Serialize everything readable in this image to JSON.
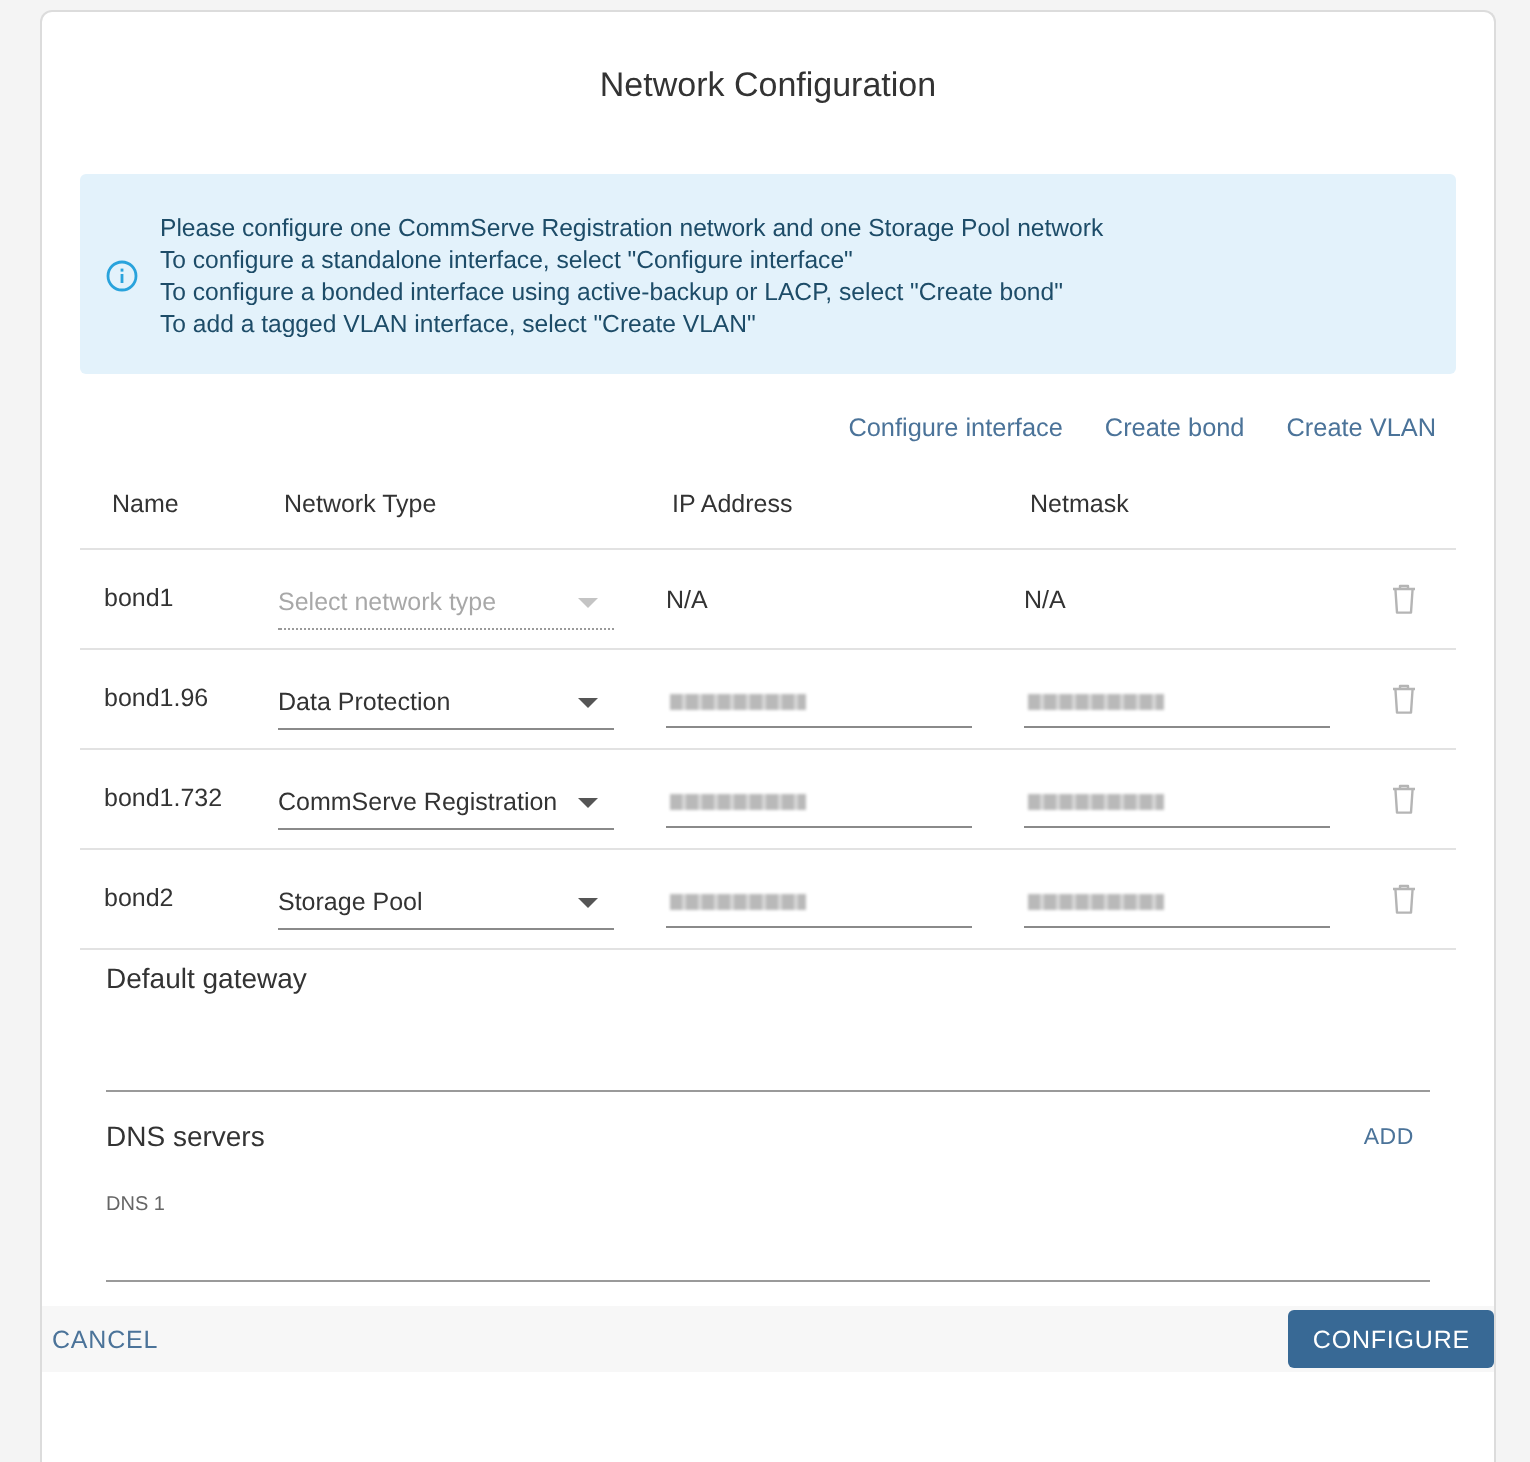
{
  "dialog": {
    "title": "Network Configuration"
  },
  "info_banner": {
    "lines": [
      "Please configure one CommServe Registration network and one Storage Pool network",
      "To configure a standalone interface, select \"Configure interface\"",
      "To configure a bonded interface using active-backup or LACP, select \"Create bond\"",
      "To add a tagged VLAN interface, select \"Create VLAN\""
    ]
  },
  "actions": [
    "Configure interface",
    "Create bond",
    "Create VLAN"
  ],
  "table": {
    "columns": [
      "Name",
      "Network Type",
      "IP Address",
      "Netmask"
    ],
    "rows": [
      {
        "name": "bond1",
        "network_type": {
          "placeholder": "Select network type",
          "disabled": true
        },
        "ip_address": {
          "kind": "text",
          "text": "N/A"
        },
        "netmask": {
          "kind": "text",
          "text": "N/A"
        }
      },
      {
        "name": "bond1.96",
        "network_type": {
          "value": "Data Protection",
          "disabled": false
        },
        "ip_address": {
          "kind": "field",
          "redacted": true
        },
        "netmask": {
          "kind": "field",
          "redacted": true
        }
      },
      {
        "name": "bond1.732",
        "network_type": {
          "value": "CommServe Registration",
          "disabled": false
        },
        "ip_address": {
          "kind": "field",
          "redacted": true
        },
        "netmask": {
          "kind": "field",
          "redacted": true
        }
      },
      {
        "name": "bond2",
        "network_type": {
          "value": "Storage Pool",
          "disabled": false
        },
        "ip_address": {
          "kind": "field",
          "redacted": true
        },
        "netmask": {
          "kind": "field",
          "redacted": true
        }
      }
    ]
  },
  "default_gateway": {
    "label": "Default gateway"
  },
  "dns_servers": {
    "label": "DNS servers",
    "add_button": "ADD",
    "fields": [
      {
        "label": "DNS 1"
      }
    ]
  },
  "footer": {
    "cancel": "CANCEL",
    "confirm": "CONFIGURE"
  }
}
